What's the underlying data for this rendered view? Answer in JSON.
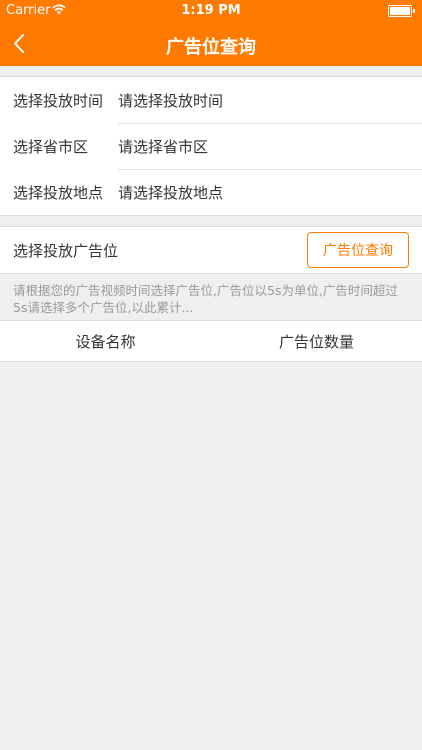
{
  "status_bar": {
    "carrier": "Carrier",
    "time": "1:19 PM"
  },
  "nav": {
    "title": "广告位查询"
  },
  "form": {
    "rows": [
      {
        "label": "选择投放时间",
        "placeholder": "请选择投放时间"
      },
      {
        "label": "选择省市区",
        "placeholder": "请选择省市区"
      },
      {
        "label": "选择投放地点",
        "placeholder": "请选择投放地点"
      }
    ]
  },
  "ad_selection": {
    "label": "选择投放广告位",
    "query_button": "广告位查询"
  },
  "hint": "请根据您的广告视频时间选择广告位,广告位以5s为单位,广告时间超过5s请选择多个广告位,以此累计...",
  "table": {
    "columns": [
      "设备名称",
      "广告位数量"
    ]
  },
  "colors": {
    "accent": "#ff7a00",
    "background": "#efefef"
  }
}
